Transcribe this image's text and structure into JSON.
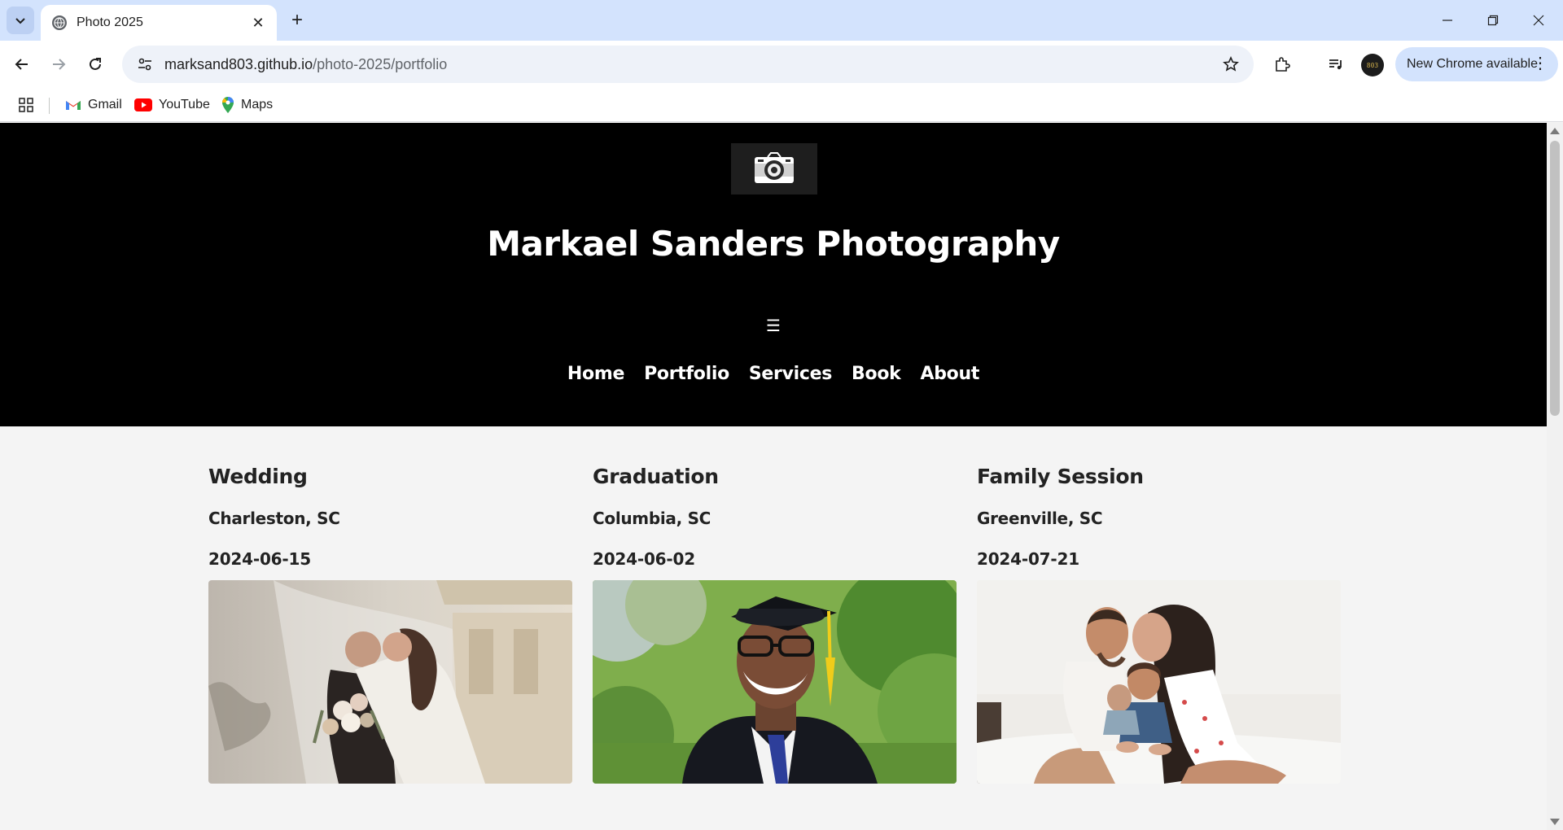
{
  "browser": {
    "tab_title": "Photo 2025",
    "url_host": "marksand803.github.io",
    "url_path": "/photo-2025/portfolio",
    "update_label": "New Chrome available",
    "avatar_text": "803",
    "bookmarks": [
      {
        "label": "Gmail",
        "icon": "gmail-icon"
      },
      {
        "label": "YouTube",
        "icon": "youtube-icon"
      },
      {
        "label": "Maps",
        "icon": "maps-icon"
      }
    ]
  },
  "site": {
    "title": "Markael Sanders Photography",
    "logo_icon": "camera-icon",
    "menu_icon": "☰",
    "nav": [
      "Home",
      "Portfolio",
      "Services",
      "Book",
      "About"
    ]
  },
  "portfolio": [
    {
      "title": "Wedding",
      "location": "Charleston, SC",
      "date": "2024-06-15",
      "image": "wedding couple with veil"
    },
    {
      "title": "Graduation",
      "location": "Columbia, SC",
      "date": "2024-06-02",
      "image": "smiling graduate in cap and gown"
    },
    {
      "title": "Family Session",
      "location": "Greenville, SC",
      "date": "2024-07-21",
      "image": "family with children on bed"
    }
  ]
}
